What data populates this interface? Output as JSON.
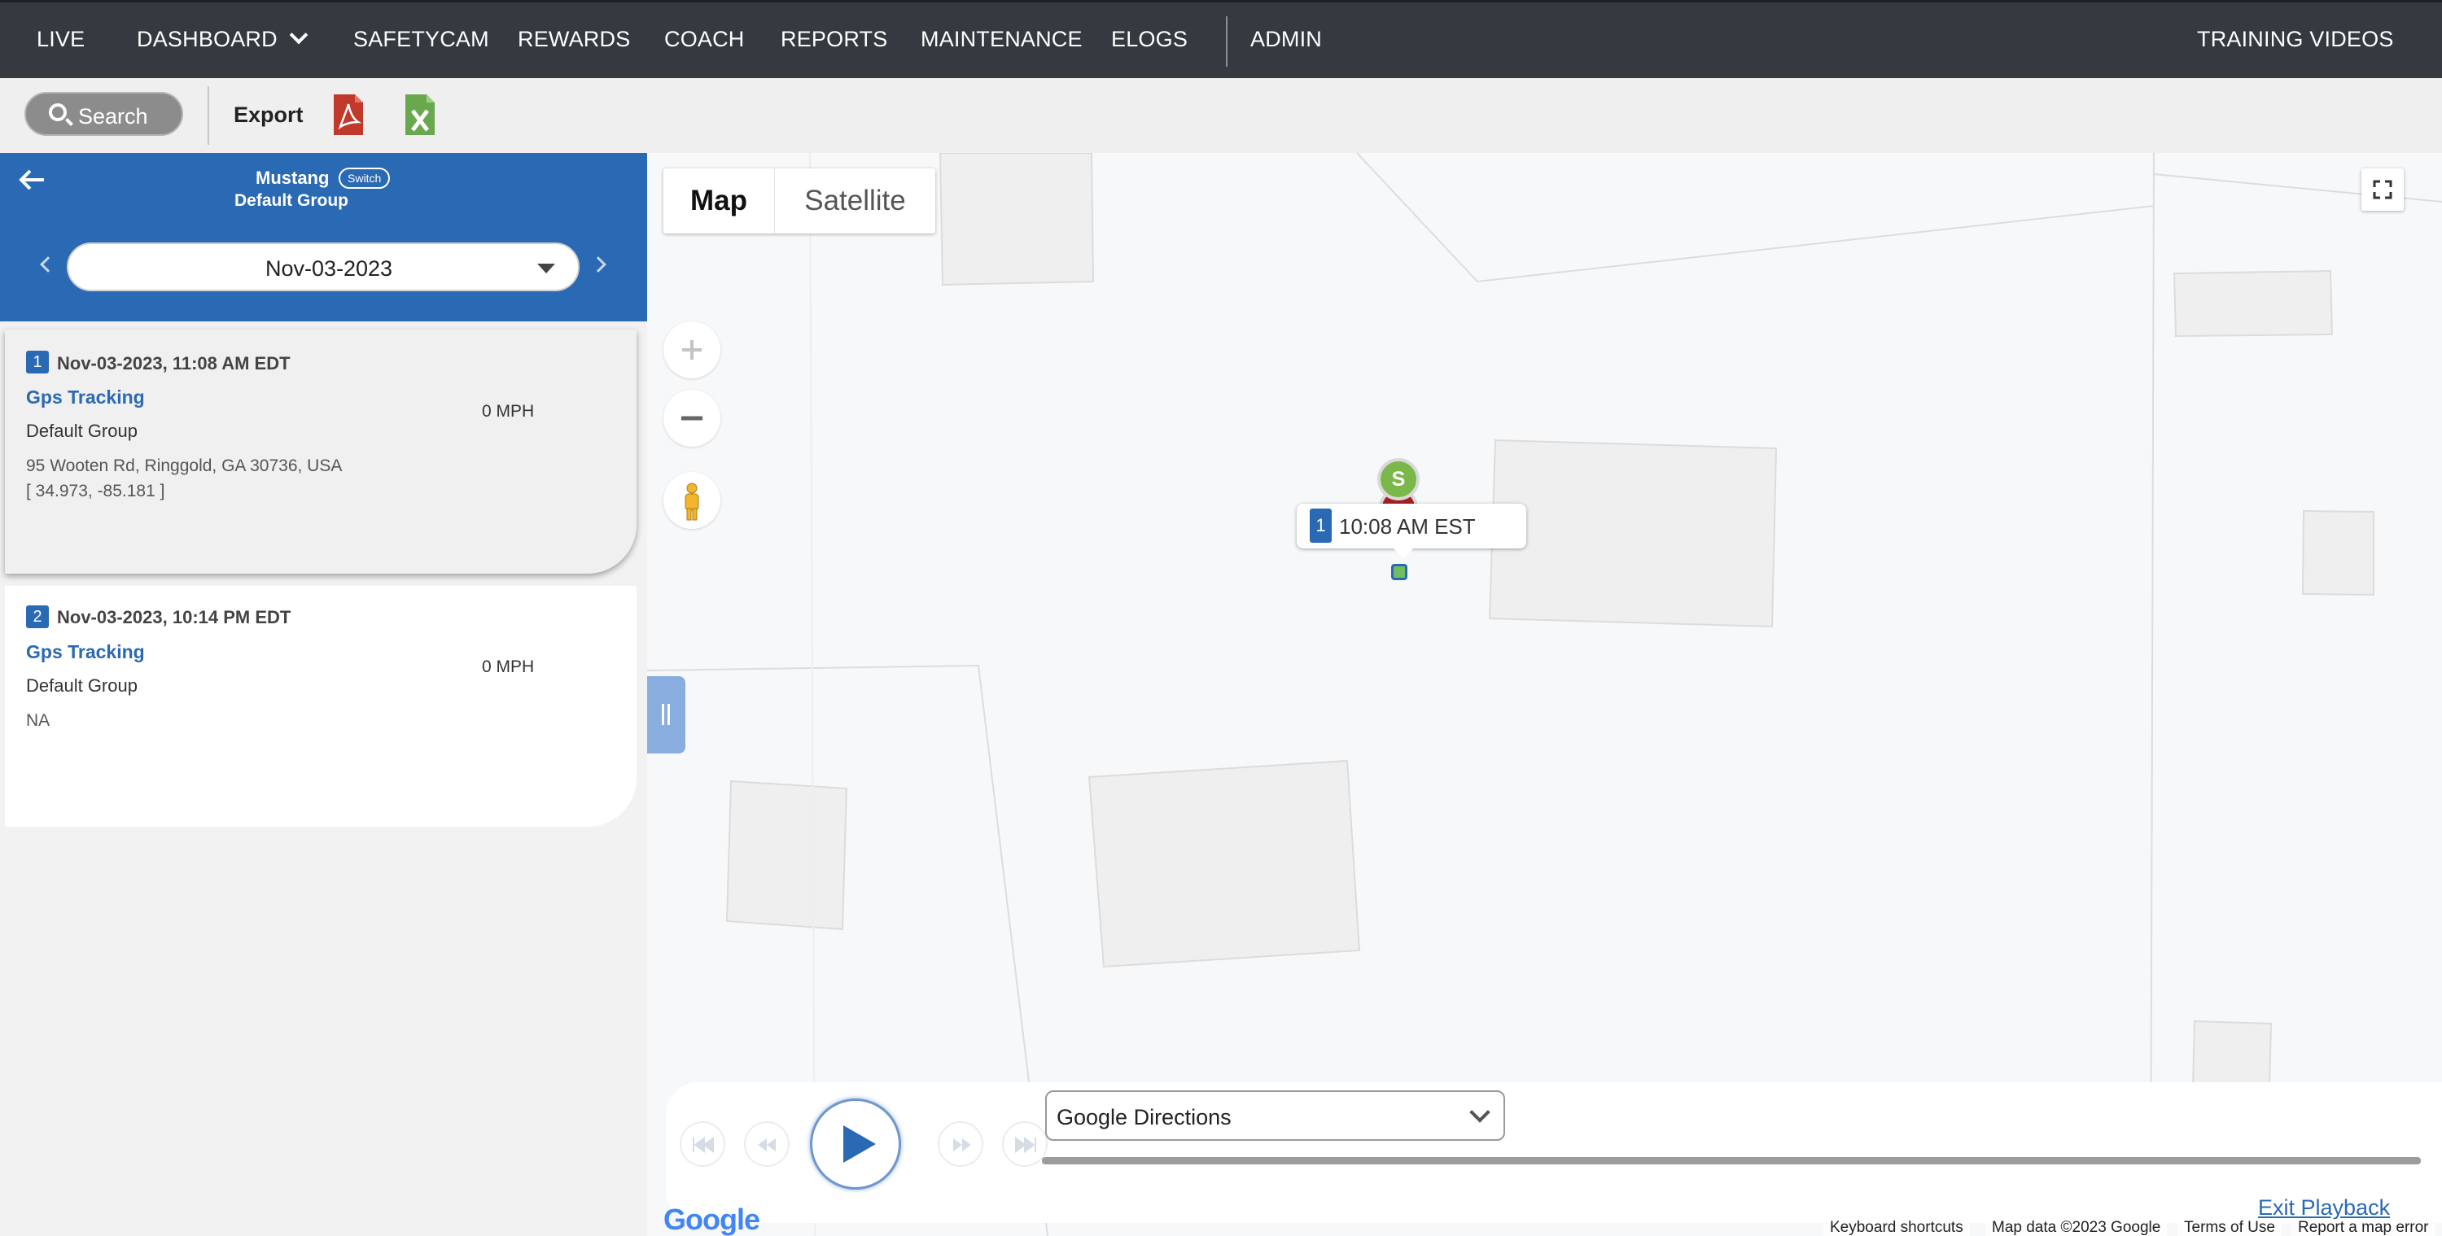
{
  "nav": {
    "items": [
      "LIVE",
      "DASHBOARD",
      "SAFETYCAM",
      "REWARDS",
      "COACH",
      "REPORTS",
      "MAINTENANCE",
      "ELOGS",
      "ADMIN"
    ],
    "right": "TRAINING VIDEOS"
  },
  "toolbar": {
    "search_label": "Search",
    "export_label": "Export"
  },
  "vehicle": {
    "name": "Mustang",
    "switch_label": "Switch",
    "group": "Default Group",
    "date": "Nov-03-2023"
  },
  "events": [
    {
      "num": "1",
      "timestamp": "Nov-03-2023, 11:08 AM EDT",
      "type": "Gps Tracking",
      "group": "Default Group",
      "speed": "0 MPH",
      "address": "95 Wooten Rd, Ringgold, GA 30736, USA",
      "coords": "[ 34.973, -85.181 ]"
    },
    {
      "num": "2",
      "timestamp": "Nov-03-2023, 10:14 PM EDT",
      "type": "Gps Tracking",
      "group": "Default Group",
      "speed": "0 MPH",
      "address": "NA",
      "coords": ""
    }
  ],
  "map": {
    "type_map": "Map",
    "type_satellite": "Satellite",
    "start_marker": "S",
    "tooltip_num": "1",
    "tooltip_time": "10:08 AM EST",
    "footer": {
      "shortcuts": "Keyboard shortcuts",
      "data": "Map data ©2023 Google",
      "terms": "Terms of Use",
      "report": "Report a map error",
      "logo": "Google"
    }
  },
  "playback": {
    "directions_value": "Google Directions",
    "exit_label": "Exit Playback"
  },
  "colors": {
    "nav_bg": "#343a40",
    "accent": "#2a69b3",
    "pdf_red": "#c0392b",
    "excel_green": "#6aa84f"
  }
}
